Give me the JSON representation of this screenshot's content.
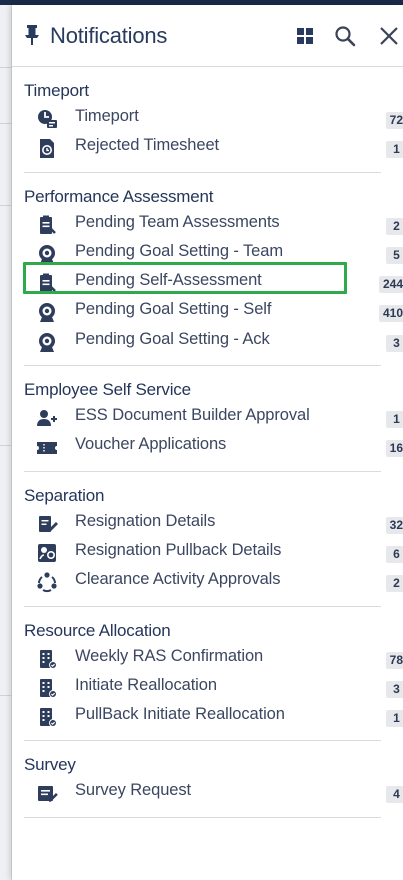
{
  "header": {
    "title": "Notifications",
    "icons": {
      "pin": "pin-icon",
      "grid": "grid-icon",
      "search": "search-icon",
      "close": "close-icon"
    }
  },
  "colors": {
    "accent": "#283a5e",
    "highlight": "#2eaa4a",
    "badge_bg": "#e6e8ec",
    "top_strip": "#1b2a49"
  },
  "sections": [
    {
      "title": "Timeport",
      "items": [
        {
          "label": "Timeport",
          "count": "72",
          "icon": "timeport-icon"
        },
        {
          "label": "Rejected Timesheet",
          "count": "1",
          "icon": "timesheet-icon"
        }
      ]
    },
    {
      "title": "Performance Assessment",
      "items": [
        {
          "label": "Pending Team Assessments",
          "count": "2",
          "icon": "assessment-icon"
        },
        {
          "label": "Pending Goal Setting - Team",
          "count": "5",
          "icon": "goal-icon"
        },
        {
          "label": "Pending Self-Assessment",
          "count": "244",
          "icon": "assessment-icon",
          "highlighted": true
        },
        {
          "label": "Pending Goal Setting - Self",
          "count": "410",
          "icon": "goal-icon"
        },
        {
          "label": "Pending Goal Setting - Ack",
          "count": "3",
          "icon": "goal-icon"
        }
      ]
    },
    {
      "title": "Employee Self Service",
      "items": [
        {
          "label": "ESS Document Builder Approval",
          "count": "1",
          "icon": "add-user-icon"
        },
        {
          "label": "Voucher Applications",
          "count": "16",
          "icon": "voucher-icon"
        }
      ]
    },
    {
      "title": "Separation",
      "items": [
        {
          "label": "Resignation Details",
          "count": "32",
          "icon": "resignation-icon"
        },
        {
          "label": "Resignation Pullback Details",
          "count": "6",
          "icon": "pullback-icon"
        },
        {
          "label": "Clearance Activity Approvals",
          "count": "2",
          "icon": "clearance-icon"
        }
      ]
    },
    {
      "title": "Resource Allocation",
      "items": [
        {
          "label": "Weekly RAS Confirmation",
          "count": "78",
          "icon": "building-icon"
        },
        {
          "label": "Initiate Reallocation",
          "count": "3",
          "icon": "building-icon"
        },
        {
          "label": "PullBack Initiate Reallocation",
          "count": "1",
          "icon": "building-icon"
        }
      ]
    },
    {
      "title": "Survey",
      "items": [
        {
          "label": "Survey Request",
          "count": "4",
          "icon": "survey-icon"
        }
      ]
    }
  ]
}
